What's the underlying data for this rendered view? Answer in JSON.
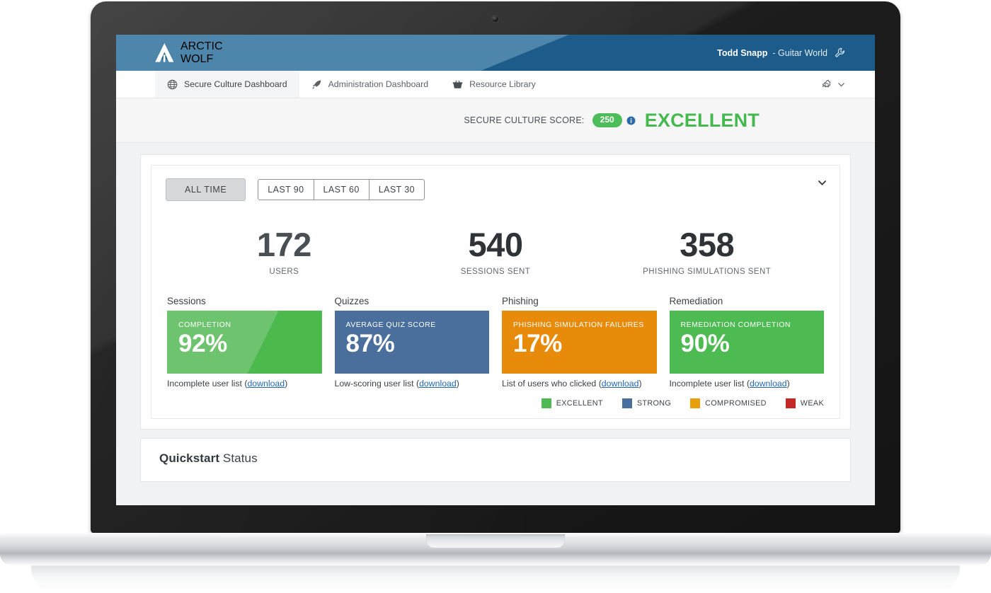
{
  "header": {
    "brand_line1": "ARCTIC",
    "brand_line2": "WOLF",
    "logo_icon": "arctic-wolf-mountain-logo",
    "account_name": "Todd Snapp",
    "account_org": "- Guitar World",
    "wrench_icon": "wrench-icon"
  },
  "nav": {
    "tabs": [
      {
        "label": "Secure Culture Dashboard",
        "icon": "globe-icon",
        "active": true
      },
      {
        "label": "Administration Dashboard",
        "icon": "rocket-icon",
        "active": false
      },
      {
        "label": "Resource Library",
        "icon": "basket-icon",
        "active": false
      }
    ],
    "settings_icon": "gear-icon",
    "chevron_icon": "chevron-down-icon"
  },
  "score": {
    "label": "SECURE CULTURE SCORE:",
    "value": "250",
    "info_icon": "info-circle-icon",
    "rating": "EXCELLENT",
    "badge_color": "#4dbd5c",
    "rating_color": "#45b94f"
  },
  "filters": {
    "all_time": "ALL TIME",
    "ranges": [
      "LAST 90",
      "LAST 60",
      "LAST 30"
    ],
    "collapse_icon": "chevron-down-icon"
  },
  "stats": [
    {
      "value": "172",
      "caption": "USERS"
    },
    {
      "value": "540",
      "caption": "SESSIONS SENT"
    },
    {
      "value": "358",
      "caption": "PHISHING SIMULATIONS SENT"
    }
  ],
  "metrics": [
    {
      "title": "Sessions",
      "kicker": "COMPLETION",
      "value": "92%",
      "footnote_prefix": "Incomplete user list (",
      "link": "download",
      "footnote_suffix": ")",
      "color": "#6ec46e"
    },
    {
      "title": "Quizzes",
      "kicker": "AVERAGE QUIZ SCORE",
      "value": "87%",
      "footnote_prefix": "Low-scoring user list (",
      "link": "download",
      "footnote_suffix": ")",
      "color": "#4a6f9c"
    },
    {
      "title": "Phishing",
      "kicker": "PHISHING SIMULATION  FAILURES",
      "value": "17%",
      "footnote_prefix": "List of users who clicked (",
      "link": "download",
      "footnote_suffix": ")",
      "color": "#e88b0a"
    },
    {
      "title": "Remediation",
      "kicker": "REMEDIATION COMPLETION",
      "value": "90%",
      "footnote_prefix": "Incomplete user list (",
      "link": "download",
      "footnote_suffix": ")",
      "color": "#4dbb52"
    }
  ],
  "legend": [
    {
      "label": "EXCELLENT",
      "color": "#4dbb52"
    },
    {
      "label": "STRONG",
      "color": "#4a6f9c"
    },
    {
      "label": "COMPROMISED",
      "color": "#e8a00a"
    },
    {
      "label": "WEAK",
      "color": "#c62828"
    }
  ],
  "quickstart": {
    "title_bold": "Quickstart",
    "title_light": " Status"
  }
}
